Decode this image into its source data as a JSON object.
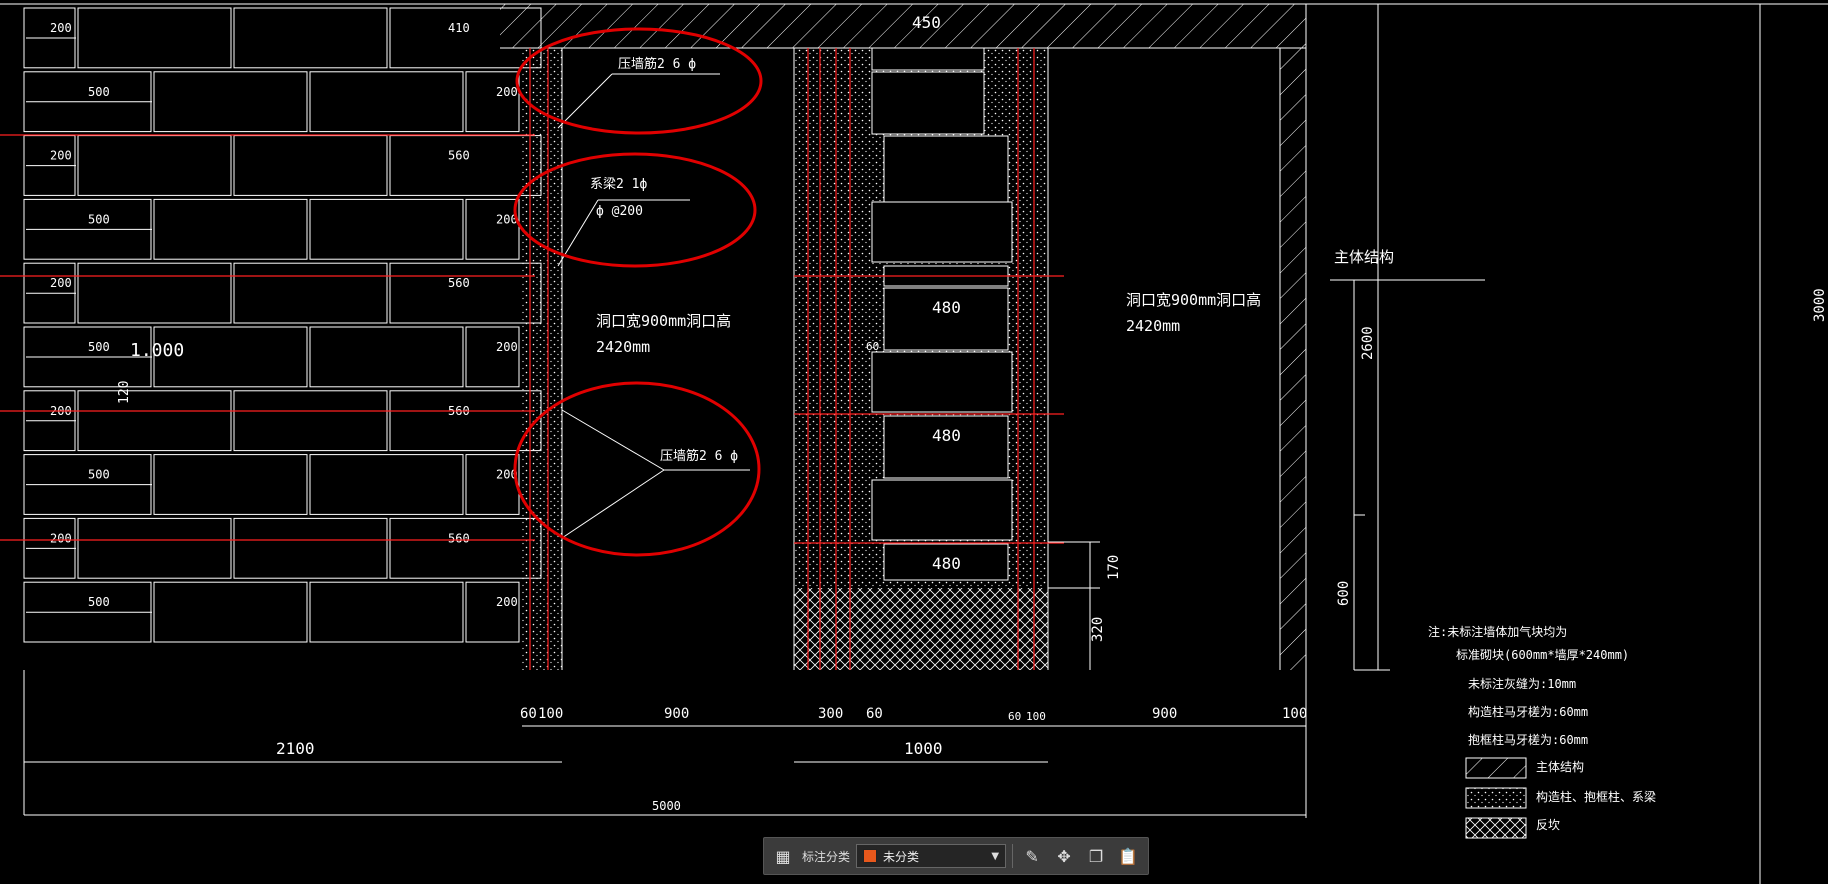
{
  "colors": {
    "background": "#000000",
    "lines": "#ffffff",
    "rebar": "#ff2020",
    "highlight_circle": "#e00000",
    "toolbar_bg": "#3b3b3b",
    "category_swatch": "#e8581c"
  },
  "wall": {
    "rows": [
      {
        "left": "200",
        "right": "410"
      },
      {
        "left": "500",
        "right": "200"
      },
      {
        "left": "200",
        "right": "560"
      },
      {
        "left": "500",
        "right": "200"
      },
      {
        "left": "200",
        "right": "560"
      },
      {
        "left": "500",
        "right": "200"
      },
      {
        "left": "200",
        "right": "560"
      },
      {
        "left": "500",
        "right": "200"
      },
      {
        "left": "200",
        "right": "560"
      },
      {
        "left": "500",
        "right": "200"
      }
    ],
    "elevation_mark": "1.000",
    "elevation_sub": "120"
  },
  "annotations": {
    "tie_bar_top": "压墙筋2  6  ф",
    "tie_beam_line1": "系梁2  1ф",
    "tie_beam_line2": "ф @200",
    "tie_bar_bottom": "压墙筋2  6  ф",
    "opening1_line1": "洞口宽900mm洞口高",
    "opening1_line2": "2420mm",
    "opening2_line1": "洞口宽900mm洞口高",
    "opening2_line2": "2420mm",
    "main_structure": "主体结构",
    "column_top": "450",
    "column_blocks": [
      "480",
      "480",
      "480"
    ],
    "column_gap": "60"
  },
  "dimensions": {
    "row1": [
      "60",
      "100",
      "900",
      "300",
      "60",
      "60",
      "100",
      "900",
      "100"
    ],
    "span_2100": "2100",
    "span_1000": "1000",
    "total": "5000",
    "h_2600": "2600",
    "h_600": "600",
    "h_170": "170",
    "h_320": "320",
    "h_3000": "3000"
  },
  "notes": {
    "line1": "注:未标注墙体加气块均为",
    "line2": "标准砌块(600mm*墙厚*240mm)",
    "line3": "未标注灰缝为:10mm",
    "line4": "构造柱马牙槎为:60mm",
    "line5": "抱框柱马牙槎为:60mm"
  },
  "legend": [
    {
      "label": "主体结构",
      "pattern": "hatch"
    },
    {
      "label": "构造柱、抱框柱、系梁",
      "pattern": "dots"
    },
    {
      "label": "反坎",
      "pattern": "cross"
    }
  ],
  "toolbar": {
    "grid_icon": "grid-icon",
    "category_label": "标注分类",
    "category_value": "未分类",
    "edit_icon": "edit-icon",
    "move_icon": "move-icon",
    "copy_icon": "copy-icon",
    "paste_icon": "paste-icon"
  }
}
